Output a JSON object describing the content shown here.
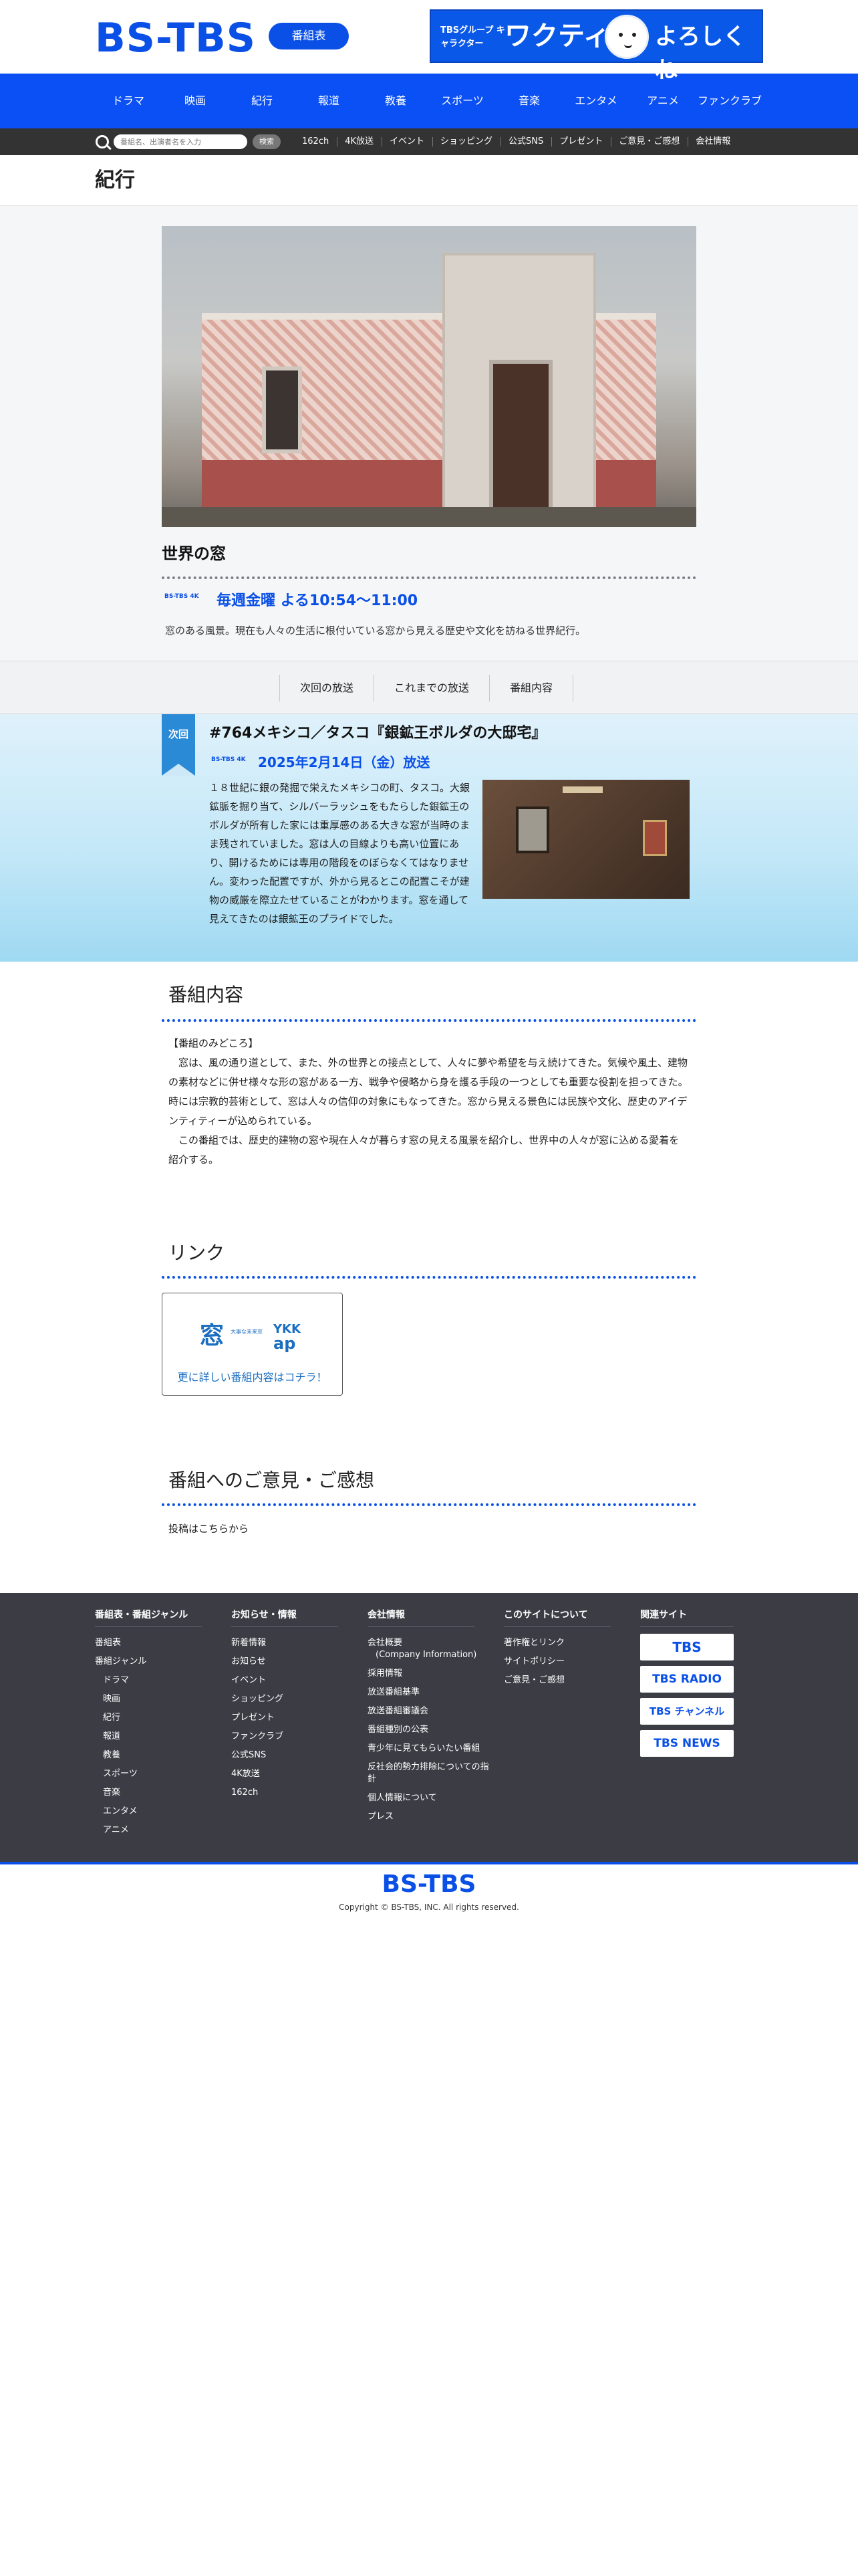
{
  "header": {
    "logo": "BS-TBS",
    "schedule_button": "番組表",
    "banner": {
      "small_text": "TBSグループ キャラクター",
      "big_text": "ワクティ",
      "greeting": "よろしくね"
    }
  },
  "global_nav": [
    "ドラマ",
    "映画",
    "紀行",
    "報道",
    "教養",
    "スポーツ",
    "音楽",
    "エンタメ",
    "アニメ",
    "ファンクラブ"
  ],
  "sub_nav": {
    "search_placeholder": "番組名、出演者名を入力",
    "search_button": "検索",
    "links": [
      "162ch",
      "4K放送",
      "イベント",
      "ショッピング",
      "公式SNS",
      "プレゼント",
      "ご意見・ご感想",
      "会社情報"
    ]
  },
  "page_title": "紀行",
  "program": {
    "name": "世界の窓",
    "channel_mark": "BS-TBS 4K",
    "schedule": "毎週金曜 よる10:54〜11:00",
    "description": "窓のある風景。現在も人々の生活に根付いている窓から見える歴史や文化を訪ねる世界紀行。"
  },
  "tabs": [
    "次回の放送",
    "これまでの放送",
    "番組内容"
  ],
  "next_broadcast": {
    "badge": "次回",
    "title": "#764メキシコ／タスコ『銀鉱王ボルダの大邸宅』",
    "channel_mark": "BS-TBS 4K",
    "date": "2025年2月14日（金）放送",
    "text": "１８世紀に銀の発掘で栄えたメキシコの町、タスコ。大銀鉱脈を掘り当て、シルバーラッシュをもたらした銀鉱王のボルダが所有した家には重厚感のある大きな窓が当時のまま残されていました。窓は人の目線よりも高い位置にあり、開けるためには専用の階段をのぼらなくてはなりません。変わった配置ですが、外から見るとこの配置こそが建物の威厳を際立たせていることがわかります。窓を通して見えてきたのは銀鉱王のプライドでした。"
  },
  "program_content": {
    "title": "番組内容",
    "heading": "【番組のみどころ】",
    "p1": "　窓は、風の通り道として、また、外の世界との接点として、人々に夢や希望を与え続けてきた。気候や風土、建物の素材などに併せ様々な形の窓がある一方、戦争や侵略から身を護る手段の一つとしても重要な役割を担ってきた。時には宗教的芸術として、窓は人々の信仰の対象にもなってきた。窓から見える景色には民族や文化、歴史のアイデンティティーが込められている。",
    "p2": "　この番組では、歴史的建物の窓や現在人々が暮らす窓の見える風景を紹介し、世界中の人々が窓に込める愛着を紹介する。"
  },
  "links_section": {
    "title": "リンク",
    "card_logo": "窓",
    "card_logo_sub": "大事な未来窓",
    "card_brand_top": "YKK",
    "card_brand_bottom": "ap",
    "card_text": "更に詳しい番組内容はコチラ！"
  },
  "feedback": {
    "title": "番組へのご意見・ご感想",
    "text": "投稿はこちらから"
  },
  "footer": {
    "col1": {
      "title": "番組表・番組ジャンル",
      "items": [
        "番組表",
        "番組ジャンル"
      ],
      "sub_items": [
        "ドラマ",
        "映画",
        "紀行",
        "報道",
        "教養",
        "スポーツ",
        "音楽",
        "エンタメ",
        "アニメ"
      ]
    },
    "col2": {
      "title": "お知らせ・情報",
      "items": [
        "新着情報",
        "お知らせ",
        "イベント",
        "ショッピング",
        "プレゼント",
        "ファンクラブ",
        "公式SNS",
        "4K放送",
        "162ch"
      ]
    },
    "col3": {
      "title": "会社情報",
      "company_overview": "会社概要",
      "company_overview_en": "(Company Information)",
      "items": [
        "採用情報",
        "放送番組基準",
        "放送番組審議会",
        "番組種別の公表",
        "青少年に見てもらいたい番組",
        "反社会的勢力排除についての指針",
        "個人情報について",
        "プレス"
      ]
    },
    "col4": {
      "title": "このサイトについて",
      "items": [
        "著作権とリンク",
        "サイトポリシー",
        "ご意見・ご感想"
      ]
    },
    "col5": {
      "title": "関連サイト",
      "items": [
        "TBS",
        "TBS RADIO",
        "TBS チャンネル",
        "TBS NEWS"
      ]
    }
  },
  "bottom": {
    "logo": "BS-TBS",
    "copyright": "Copyright © BS-TBS, INC. All rights reserved."
  },
  "colors": {
    "brand_blue": "#0a50f5",
    "subnav_bg": "#333333",
    "footer_bg": "#3b3c44"
  }
}
